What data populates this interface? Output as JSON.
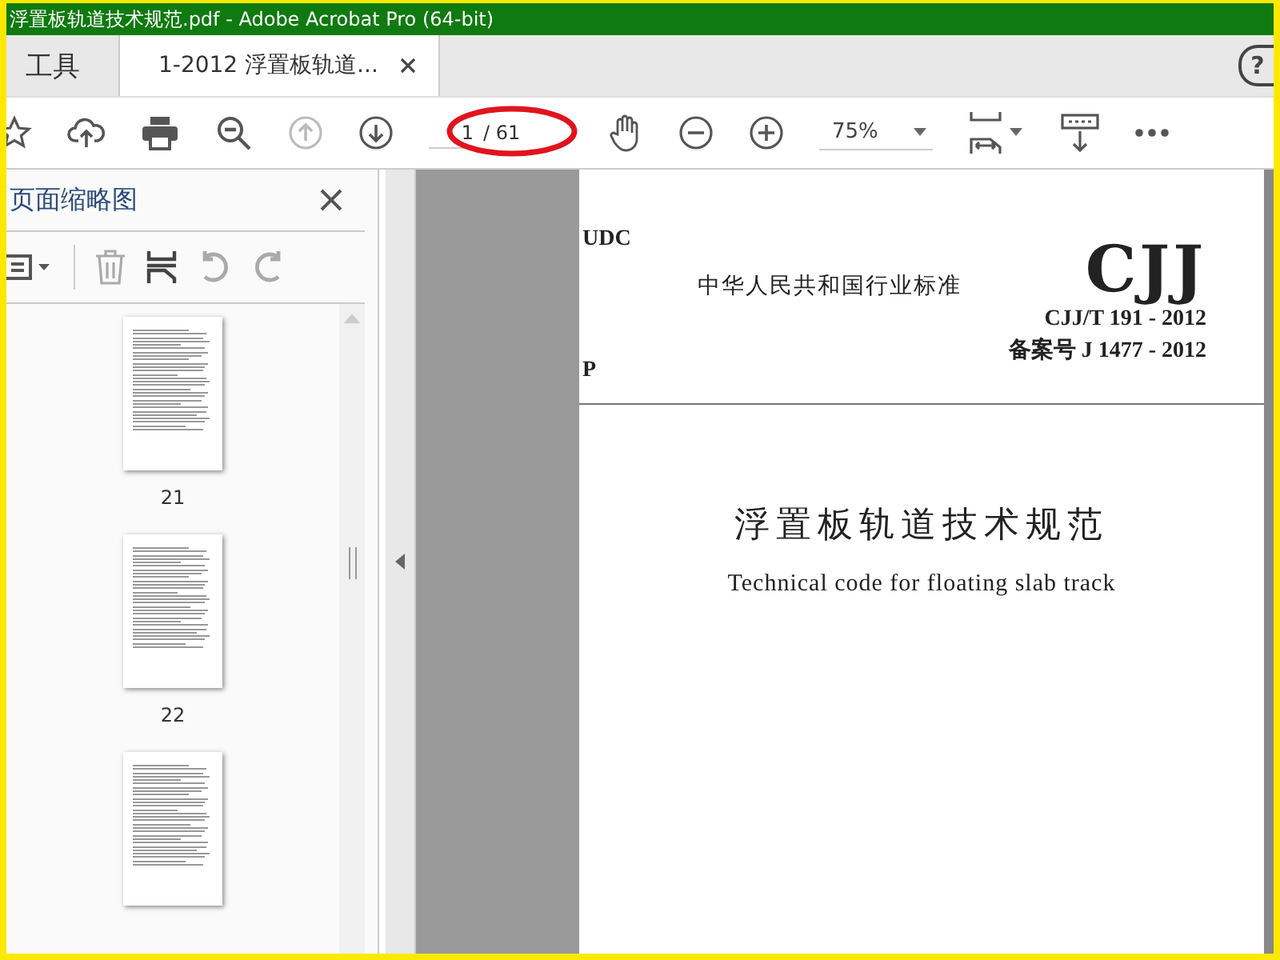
{
  "window": {
    "title": "浮置板轨道技术规范.pdf - Adobe Acrobat Pro (64-bit)"
  },
  "tabs": [
    {
      "label": "工具",
      "selected": false,
      "closable": false
    },
    {
      "label": "1-2012 浮置板轨道...",
      "selected": true,
      "closable": true
    }
  ],
  "help": "?",
  "toolbar": {
    "page_number": "1",
    "page_total": "/ 61",
    "zoom": "75%"
  },
  "annotation": {
    "kind": "ellipse",
    "color": "#e0141e"
  },
  "thumbnails_panel": {
    "title": "页面缩略图",
    "pages": [
      {
        "label": "21",
        "selected": false
      },
      {
        "label": "22",
        "selected": false
      },
      {
        "selected": false
      }
    ]
  },
  "document": {
    "udc": "UDC",
    "classification": "P",
    "standard_body": "中华人民共和国行业标准",
    "logo": "CJJ",
    "code": "CJJ/T 191 - 2012",
    "record_number": "备案号 J 1477 - 2012",
    "title": "浮置板轨道技术规范",
    "english_title": "Technical code for floating slab track"
  }
}
